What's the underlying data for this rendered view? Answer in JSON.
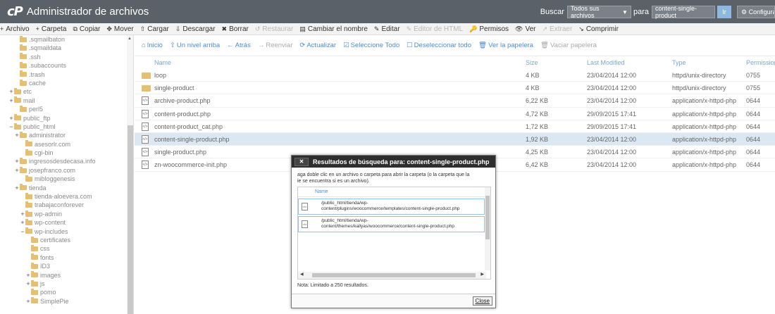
{
  "header": {
    "logo": "cP",
    "title": "Administrador de archivos",
    "search_label": "Buscar",
    "search_scope": "Todos sus archivos",
    "para_label": "para",
    "search_value": "content-single-product",
    "go_label": "Ir",
    "config_label": "Configuración"
  },
  "toolbar": [
    {
      "icon": "+",
      "label": "Archivo",
      "enabled": true
    },
    {
      "icon": "+",
      "label": "Carpeta",
      "enabled": true
    },
    {
      "icon": "⧉",
      "label": "Copiar",
      "enabled": true
    },
    {
      "icon": "✥",
      "label": "Mover",
      "enabled": true
    },
    {
      "icon": "⇧",
      "label": "Cargar",
      "enabled": true
    },
    {
      "icon": "⇩",
      "label": "Descargar",
      "enabled": true
    },
    {
      "icon": "✖",
      "label": "Borrar",
      "enabled": true
    },
    {
      "icon": "↺",
      "label": "Restaurar",
      "enabled": false
    },
    {
      "icon": "▤",
      "label": "Cambiar el nombre",
      "enabled": true
    },
    {
      "icon": "✎",
      "label": "Editar",
      "enabled": true
    },
    {
      "icon": "✎",
      "label": "Editor de HTML",
      "enabled": false
    },
    {
      "icon": "🔑",
      "label": "Permisos",
      "enabled": true
    },
    {
      "icon": "👁",
      "label": "Ver",
      "enabled": true
    },
    {
      "icon": "↗",
      "label": "Extraer",
      "enabled": false
    },
    {
      "icon": "↘",
      "label": "Comprimir",
      "enabled": true
    }
  ],
  "sidebar": {
    "tree": [
      {
        "depth": 3,
        "exp": "",
        "label": ".sqmailbaton"
      },
      {
        "depth": 3,
        "exp": "",
        "label": ".sqmaildata"
      },
      {
        "depth": 3,
        "exp": "",
        "label": ".ssh"
      },
      {
        "depth": 3,
        "exp": "",
        "label": ".subaccounts"
      },
      {
        "depth": 3,
        "exp": "",
        "label": ".trash"
      },
      {
        "depth": 3,
        "exp": "",
        "label": "cache"
      },
      {
        "depth": 2,
        "exp": "+",
        "label": "etc"
      },
      {
        "depth": 2,
        "exp": "+",
        "label": "mail"
      },
      {
        "depth": 3,
        "exp": "",
        "label": "perl5"
      },
      {
        "depth": 2,
        "exp": "+",
        "label": "public_ftp"
      },
      {
        "depth": 2,
        "exp": "−",
        "label": "public_html"
      },
      {
        "depth": 3,
        "exp": "+",
        "label": "administrator"
      },
      {
        "depth": 4,
        "exp": "",
        "label": "asesorlr.com"
      },
      {
        "depth": 4,
        "exp": "",
        "label": "cgi-bin"
      },
      {
        "depth": 3,
        "exp": "+",
        "label": "ingresosdesdecasa.info"
      },
      {
        "depth": 3,
        "exp": "+",
        "label": "josepfranco.com"
      },
      {
        "depth": 4,
        "exp": "",
        "label": "mibloggenesis"
      },
      {
        "depth": 3,
        "exp": "+",
        "label": "tienda"
      },
      {
        "depth": 4,
        "exp": "",
        "label": "tienda-aloevera.com"
      },
      {
        "depth": 4,
        "exp": "",
        "label": "trabajaconforever"
      },
      {
        "depth": 4,
        "exp": "+",
        "label": "wp-admin"
      },
      {
        "depth": 4,
        "exp": "+",
        "label": "wp-content"
      },
      {
        "depth": 4,
        "exp": "−",
        "label": "wp-includes"
      },
      {
        "depth": 5,
        "exp": "",
        "label": "certificates"
      },
      {
        "depth": 5,
        "exp": "",
        "label": "css"
      },
      {
        "depth": 5,
        "exp": "",
        "label": "fonts"
      },
      {
        "depth": 5,
        "exp": "",
        "label": "ID3"
      },
      {
        "depth": 5,
        "exp": "+",
        "label": "images"
      },
      {
        "depth": 5,
        "exp": "+",
        "label": "js"
      },
      {
        "depth": 5,
        "exp": "",
        "label": "pomo"
      },
      {
        "depth": 5,
        "exp": "+",
        "label": "SimplePie"
      }
    ]
  },
  "nav": [
    {
      "icon": "⌂",
      "label": "Inicio",
      "enabled": true
    },
    {
      "icon": "⇧",
      "label": "Un nivel arriba",
      "enabled": true
    },
    {
      "icon": "←",
      "label": "Atrás",
      "enabled": true
    },
    {
      "icon": "→",
      "label": "Reenviar",
      "enabled": false
    },
    {
      "icon": "⟳",
      "label": "Actualizar",
      "enabled": true
    },
    {
      "icon": "☑",
      "label": "Seleccione Todo",
      "enabled": true
    },
    {
      "icon": "☐",
      "label": "Deseleccionar todo",
      "enabled": true
    },
    {
      "icon": "🗑",
      "label": "Ver la papelera",
      "enabled": true
    },
    {
      "icon": "🗑",
      "label": "Vaciar papelera",
      "enabled": false
    }
  ],
  "columns": {
    "name": "Name",
    "size": "Size",
    "modified": "Last Modified",
    "type": "Type",
    "perms": "Permissions"
  },
  "files": [
    {
      "kind": "folder",
      "name": "loop",
      "size": "4 KB",
      "modified": "23/04/2014 12:00",
      "type": "httpd/unix-directory",
      "perms": "0755",
      "selected": false
    },
    {
      "kind": "folder",
      "name": "single-product",
      "size": "4 KB",
      "modified": "23/04/2014 12:00",
      "type": "httpd/unix-directory",
      "perms": "0755",
      "selected": false
    },
    {
      "kind": "php",
      "name": "archive-product.php",
      "size": "6,22 KB",
      "modified": "23/04/2014 12:00",
      "type": "application/x-httpd-php",
      "perms": "0644",
      "selected": false
    },
    {
      "kind": "php",
      "name": "content-product.php",
      "size": "4,72 KB",
      "modified": "29/09/2015 17:41",
      "type": "application/x-httpd-php",
      "perms": "0644",
      "selected": false
    },
    {
      "kind": "php",
      "name": "content-product_cat.php",
      "size": "1,72 KB",
      "modified": "29/09/2015 17:41",
      "type": "application/x-httpd-php",
      "perms": "0644",
      "selected": false
    },
    {
      "kind": "php",
      "name": "content-single-product.php",
      "size": "1,92 KB",
      "modified": "23/04/2014 12:00",
      "type": "application/x-httpd-php",
      "perms": "0644",
      "selected": true
    },
    {
      "kind": "php",
      "name": "single-product.php",
      "size": "4,25 KB",
      "modified": "23/04/2014 12:00",
      "type": "application/x-httpd-php",
      "perms": "0644",
      "selected": false
    },
    {
      "kind": "php",
      "name": "zn-woocommerce-init.php",
      "size": "6,42 KB",
      "modified": "23/04/2014 12:00",
      "type": "application/x-httpd-php",
      "perms": "0644",
      "selected": false
    }
  ],
  "modal": {
    "close_x": "✕",
    "title": "Resultados de búsqueda para: content-single-product.php",
    "message_line1": "aga doble clic en un archivo o carpeta para abrir la carpeta (o la carpeta que la",
    "message_line2": "ie se encuentra si es un archivo).",
    "col_name": "Name",
    "results": [
      {
        "line1": "/public_html/tienda/wp-",
        "line2": "content/plugins/woocommerce/templates/content-single-product.php"
      },
      {
        "line1": "/public_html/tienda/wp-",
        "line2": "content/themes/kallyas/woocommerce/content-single-product.php"
      }
    ],
    "note": "Nota: Limitado a 250 resultados.",
    "close_label": "Close"
  },
  "colors": {
    "topbar": "#5b6168",
    "link": "#4d8fd1",
    "folder": "#e6bf72",
    "selected_row": "#dbe8f4"
  }
}
